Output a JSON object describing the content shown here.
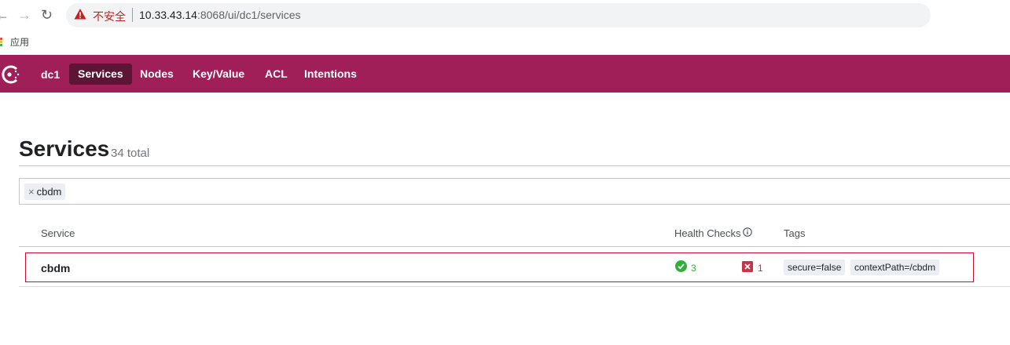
{
  "browser": {
    "nav": {
      "back": "←",
      "forward": "→",
      "reload": "↻"
    },
    "security_warning": "不安全",
    "url_host": "10.33.43.14",
    "url_rest": ":8068/ui/dc1/services",
    "bookmark_label": "应用"
  },
  "header": {
    "datacenter": "dc1",
    "nav": [
      "Services",
      "Nodes",
      "Key/Value",
      "ACL",
      "Intentions"
    ],
    "active_nav": "Services",
    "colors": {
      "header_bg": "#a01f58",
      "active_bg": "#5d1537"
    }
  },
  "page": {
    "title": "Services",
    "count": "34 total"
  },
  "search": {
    "chip_remove": "×",
    "chip_value": "cbdm"
  },
  "table": {
    "headers": {
      "service": "Service",
      "health": "Health Checks",
      "tags": "Tags"
    },
    "rows": [
      {
        "name": "cbdm",
        "passing": "3",
        "critical": "1",
        "tags": [
          "secure=false",
          "contextPath=/cbdm"
        ]
      }
    ],
    "colors": {
      "passing": "#2eb039",
      "critical": "#c73445",
      "highlight": "#c8102e"
    }
  },
  "icons": {
    "warning": "warning-triangle-icon",
    "apps": "apps-grid-icon",
    "logo": "consul-logo-icon",
    "info": "info-circle-icon",
    "passing": "check-circle-icon",
    "critical": "x-square-icon"
  }
}
